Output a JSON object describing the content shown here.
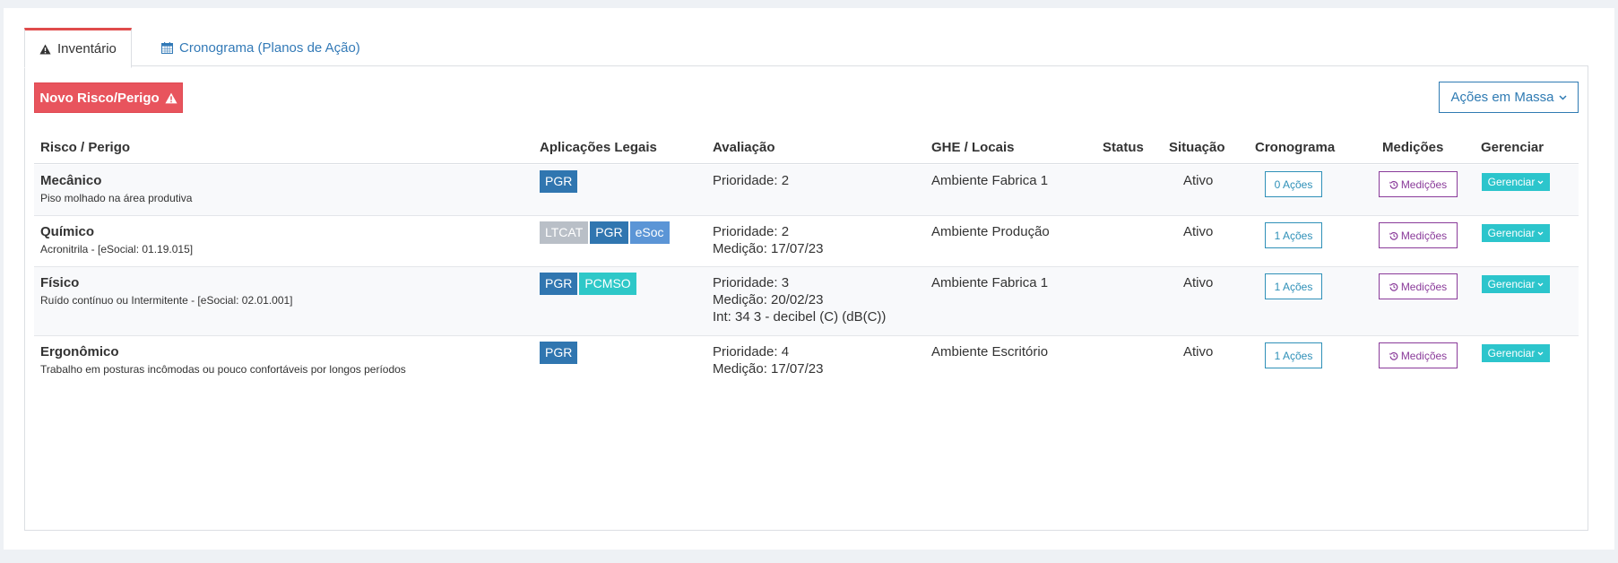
{
  "tabs": [
    {
      "label": "Inventário",
      "icon": "warning-icon"
    },
    {
      "label": "Cronograma (Planos de Ação)",
      "icon": "calendar-icon"
    }
  ],
  "toolbar": {
    "novo_label": "Novo Risco/Perigo",
    "massa_label": "Ações em Massa"
  },
  "columns": [
    "Risco / Perigo",
    "Aplicações Legais",
    "Avaliação",
    "GHE / Locais",
    "Status",
    "Situação",
    "Cronograma",
    "Medições",
    "Gerenciar"
  ],
  "rows": [
    {
      "title": "Mecânico",
      "desc": "Piso molhado na área produtiva",
      "badges": [
        "PGR"
      ],
      "avaliacao": [
        "Prioridade: 2"
      ],
      "ghe": "Ambiente Fabrica 1",
      "status": "",
      "situacao": "Ativo",
      "cronograma": "0 Ações",
      "medicoes": "Medições",
      "gerenciar": "Gerenciar"
    },
    {
      "title": "Químico",
      "desc": "Acronitrila - [eSocial: 01.19.015]",
      "badges": [
        "LTCAT",
        "PGR",
        "eSoc"
      ],
      "avaliacao": [
        "Prioridade: 2",
        "Medição: 17/07/23"
      ],
      "ghe": "Ambiente Produção",
      "status": "",
      "situacao": "Ativo",
      "cronograma": "1 Ações",
      "medicoes": "Medições",
      "gerenciar": "Gerenciar"
    },
    {
      "title": "Físico",
      "desc": "Ruído contínuo ou Intermitente - [eSocial: 02.01.001]",
      "badges": [
        "PGR",
        "PCMSO"
      ],
      "avaliacao": [
        "Prioridade: 3",
        "Medição: 20/02/23",
        "Int: 34 3 - decibel (C) (dB(C))"
      ],
      "ghe": "Ambiente Fabrica 1",
      "status": "",
      "situacao": "Ativo",
      "cronograma": "1 Ações",
      "medicoes": "Medições",
      "gerenciar": "Gerenciar"
    },
    {
      "title": "Ergonômico",
      "desc": "Trabalho em posturas incômodas ou pouco confortáveis por longos períodos",
      "badges": [
        "PGR"
      ],
      "avaliacao": [
        "Prioridade: 4",
        "Medição: 17/07/23"
      ],
      "ghe": "Ambiente Escritório",
      "status": "",
      "situacao": "Ativo",
      "cronograma": "1 Ações",
      "medicoes": "Medições",
      "gerenciar": "Gerenciar"
    }
  ],
  "colors": {
    "danger": "#e8545d",
    "primary": "#3076b0",
    "info": "#2cc5cc",
    "purple": "#8a3b9a"
  }
}
